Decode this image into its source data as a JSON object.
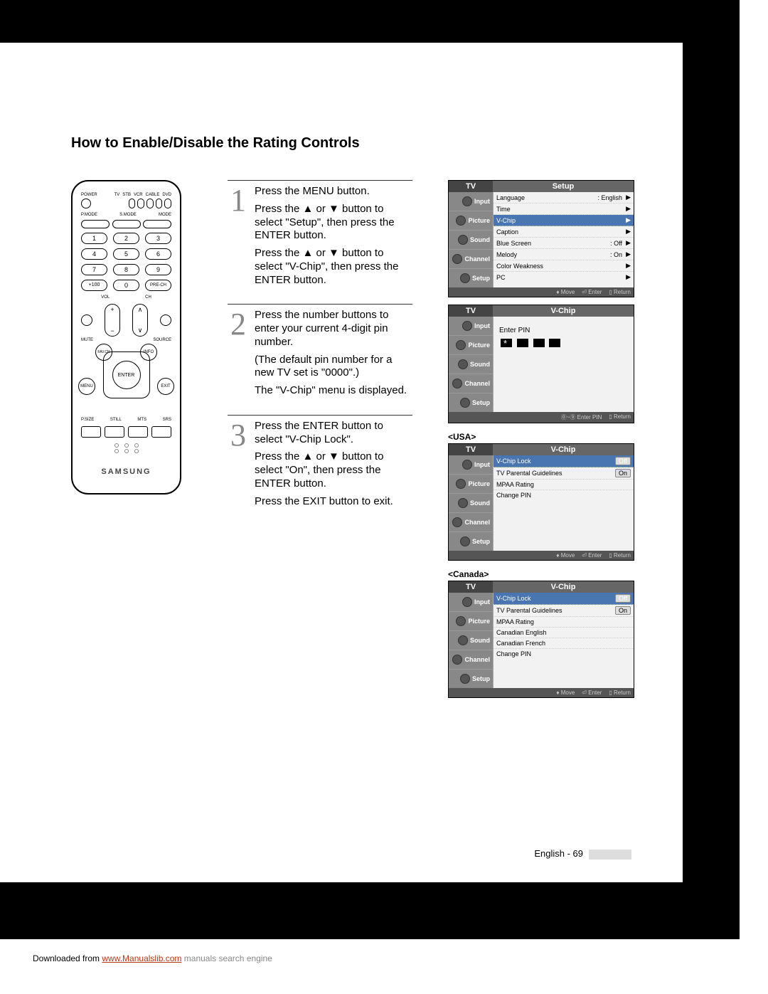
{
  "title": "How to Enable/Disable the Rating Controls",
  "remote": {
    "top_labels": [
      "POWER",
      "TV",
      "STB",
      "VCR",
      "CABLE",
      "DVD"
    ],
    "mode_labels": [
      "P.MODE",
      "S.MODE",
      "MODE"
    ],
    "numpad": [
      "1",
      "2",
      "3",
      "4",
      "5",
      "6",
      "7",
      "8",
      "9",
      "+100",
      "0",
      "PRE-CH"
    ],
    "side_small": [
      "MUTE",
      "SOURCE"
    ],
    "volch": [
      "VOL",
      "CH"
    ],
    "center_btns": [
      "MENU",
      "FAV.CH",
      "INFO",
      "EXIT"
    ],
    "enter": "ENTER",
    "four": [
      "P.SIZE",
      "STILL",
      "MTS",
      "SRS"
    ],
    "brand": "SAMSUNG"
  },
  "steps": [
    {
      "num": "1",
      "p1": "Press the MENU button.",
      "p2": "Press the ▲ or ▼ button to select \"Setup\", then press the ENTER button.",
      "p3": "Press the ▲ or ▼ button to select \"V-Chip\", then press the ENTER button."
    },
    {
      "num": "2",
      "p1": "Press the number buttons to enter your current 4-digit pin number.",
      "p2": "(The default pin number for a new TV set is \"0000\".)",
      "p3": "The \"V-Chip\" menu is displayed."
    },
    {
      "num": "3",
      "p1": "Press the ENTER button to select \"V-Chip Lock\".",
      "p2": "Press the ▲ or ▼ button to select \"On\", then press the ENTER button.",
      "p3": "Press the EXIT button to exit."
    }
  ],
  "osd": {
    "sidebar": [
      "Input",
      "Picture",
      "Sound",
      "Channel",
      "Setup"
    ],
    "tv": "TV",
    "screen1": {
      "title": "Setup",
      "rows": [
        {
          "label": "Language",
          "value": ": English",
          "arrow": true
        },
        {
          "label": "Time",
          "value": "",
          "arrow": true
        },
        {
          "label": "V-Chip",
          "value": "",
          "arrow": true,
          "highlight": true
        },
        {
          "label": "Caption",
          "value": "",
          "arrow": true
        },
        {
          "label": "Blue Screen",
          "value": ": Off",
          "arrow": true
        },
        {
          "label": "Melody",
          "value": ": On",
          "arrow": true
        },
        {
          "label": "Color Weakness",
          "value": "",
          "arrow": true
        },
        {
          "label": "PC",
          "value": "",
          "arrow": true
        }
      ],
      "footer": [
        "Move",
        "Enter",
        "Return"
      ]
    },
    "screen2": {
      "title": "V-Chip",
      "pin_label": "Enter PIN",
      "footer": [
        "Enter PIN",
        "Return"
      ]
    },
    "usa_label": "<USA>",
    "screen3": {
      "title": "V-Chip",
      "rows": [
        {
          "label": "V-Chip Lock",
          "val": "Off",
          "highlight": true
        },
        {
          "label": "TV Parental Guidelines",
          "val": "On"
        },
        {
          "label": "MPAA Rating"
        },
        {
          "label": "Change PIN"
        }
      ],
      "footer": [
        "Move",
        "Enter",
        "Return"
      ]
    },
    "canada_label": "<Canada>",
    "screen4": {
      "title": "V-Chip",
      "rows": [
        {
          "label": "V-Chip Lock",
          "val": "Off",
          "highlight": true
        },
        {
          "label": "TV Parental Guidelines",
          "val": "On"
        },
        {
          "label": "MPAA Rating"
        },
        {
          "label": "Canadian English"
        },
        {
          "label": "Canadian French"
        },
        {
          "label": "Change PIN"
        }
      ],
      "footer": [
        "Move",
        "Enter",
        "Return"
      ]
    }
  },
  "page_num": "English - 69",
  "download": {
    "pre": "Downloaded from ",
    "link": "www.Manualslib.com",
    "post": " manuals search engine"
  }
}
